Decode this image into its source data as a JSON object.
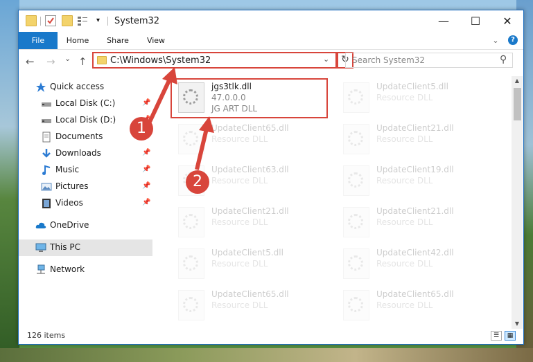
{
  "window": {
    "title": "System32",
    "controls": {
      "minimize": "—",
      "maximize": "☐",
      "close": "✕"
    }
  },
  "ribbon": {
    "tabs": [
      "File",
      "Home",
      "Share",
      "View"
    ],
    "expand": "⌄",
    "help": "?"
  },
  "nav": {
    "back": "←",
    "forward": "→",
    "recent": "⌄",
    "up": "↑",
    "address": "C:\\Windows\\System32",
    "dropdown": "⌄",
    "refresh": "↻",
    "search_placeholder": "Search System32",
    "search_icon": "⚲"
  },
  "sidebar": {
    "items": [
      {
        "label": "Quick access",
        "icon": "star-icon"
      },
      {
        "label": "Local Disk (C:)",
        "icon": "drive-icon",
        "pinned": true
      },
      {
        "label": "Local Disk (D:)",
        "icon": "drive-icon",
        "pinned": true
      },
      {
        "label": "Documents",
        "icon": "documents-icon",
        "pinned": true
      },
      {
        "label": "Downloads",
        "icon": "downloads-icon",
        "pinned": true
      },
      {
        "label": "Music",
        "icon": "music-icon",
        "pinned": true
      },
      {
        "label": "Pictures",
        "icon": "pictures-icon",
        "pinned": true
      },
      {
        "label": "Videos",
        "icon": "videos-icon",
        "pinned": true
      },
      {
        "label": "OneDrive",
        "icon": "cloud-icon"
      },
      {
        "label": "This PC",
        "icon": "computer-icon"
      },
      {
        "label": "Network",
        "icon": "network-icon"
      }
    ]
  },
  "files": {
    "highlighted": {
      "name": "jgs3tlk.dll",
      "version": "47.0.0.0",
      "description": "JG ART DLL"
    },
    "left_column": [
      {
        "name": "UpdateClient65.dll",
        "type": "Resource DLL"
      },
      {
        "name": "UpdateClient63.dll",
        "type": "Resource DLL"
      },
      {
        "name": "UpdateClient21.dll",
        "type": "Resource DLL"
      },
      {
        "name": "UpdateClient5.dll",
        "type": "Resource DLL"
      },
      {
        "name": "UpdateClient65.dll",
        "type": "Resource DLL"
      }
    ],
    "right_column": [
      {
        "name": "UpdateClient5.dll",
        "type": "Resource DLL"
      },
      {
        "name": "UpdateClient21.dll",
        "type": "Resource DLL"
      },
      {
        "name": "UpdateClient19.dll",
        "type": "Resource DLL"
      },
      {
        "name": "UpdateClient21.dll",
        "type": "Resource DLL"
      },
      {
        "name": "UpdateClient42.dll",
        "type": "Resource DLL"
      },
      {
        "name": "UpdateClient65.dll",
        "type": "Resource DLL"
      }
    ]
  },
  "status": {
    "item_count": "126 items"
  },
  "callouts": [
    "1",
    "2"
  ],
  "colors": {
    "accent": "#1979ca",
    "highlight": "#d8453b"
  }
}
